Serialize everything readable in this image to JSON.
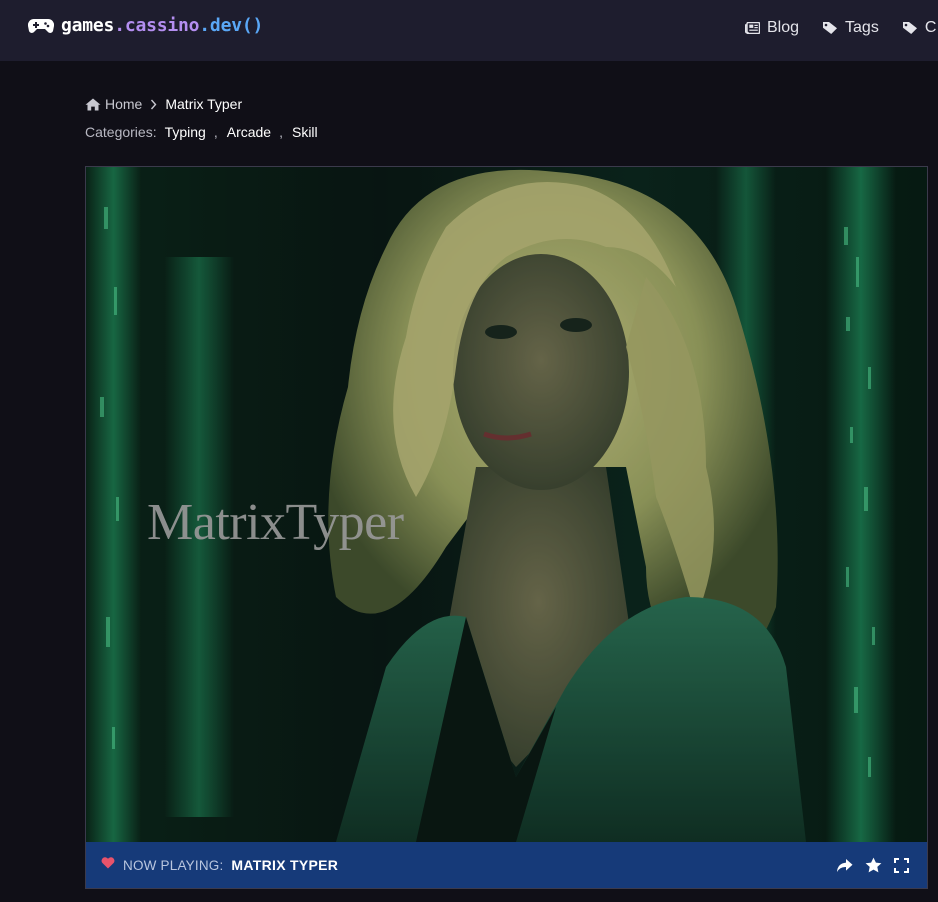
{
  "brand": {
    "part1": "games",
    "part2": ".cassino",
    "part3": ".dev()",
    "icon": "gamepad-icon"
  },
  "nav": {
    "items": [
      {
        "label": "Blog",
        "icon": "newspaper-icon"
      },
      {
        "label": "Tags",
        "icon": "tag-icon"
      },
      {
        "label": "C",
        "icon": "tags-icon"
      }
    ]
  },
  "breadcrumb": {
    "home": "Home",
    "current": "Matrix Typer"
  },
  "categories": {
    "label": "Categories:",
    "items": [
      "Typing",
      "Arcade",
      "Skill"
    ],
    "separator": ","
  },
  "game": {
    "overlay_title": "MatrixTyper",
    "now_playing_label": "NOW PLAYING:",
    "now_playing_title": "MATRIX TYPER"
  },
  "colors": {
    "topbar": "#1e1d2e",
    "background": "#100f17",
    "status_bar": "#163a79",
    "heart": "#e8536b",
    "brand_purple": "#b48ef0",
    "brand_blue": "#5aa7f6"
  }
}
